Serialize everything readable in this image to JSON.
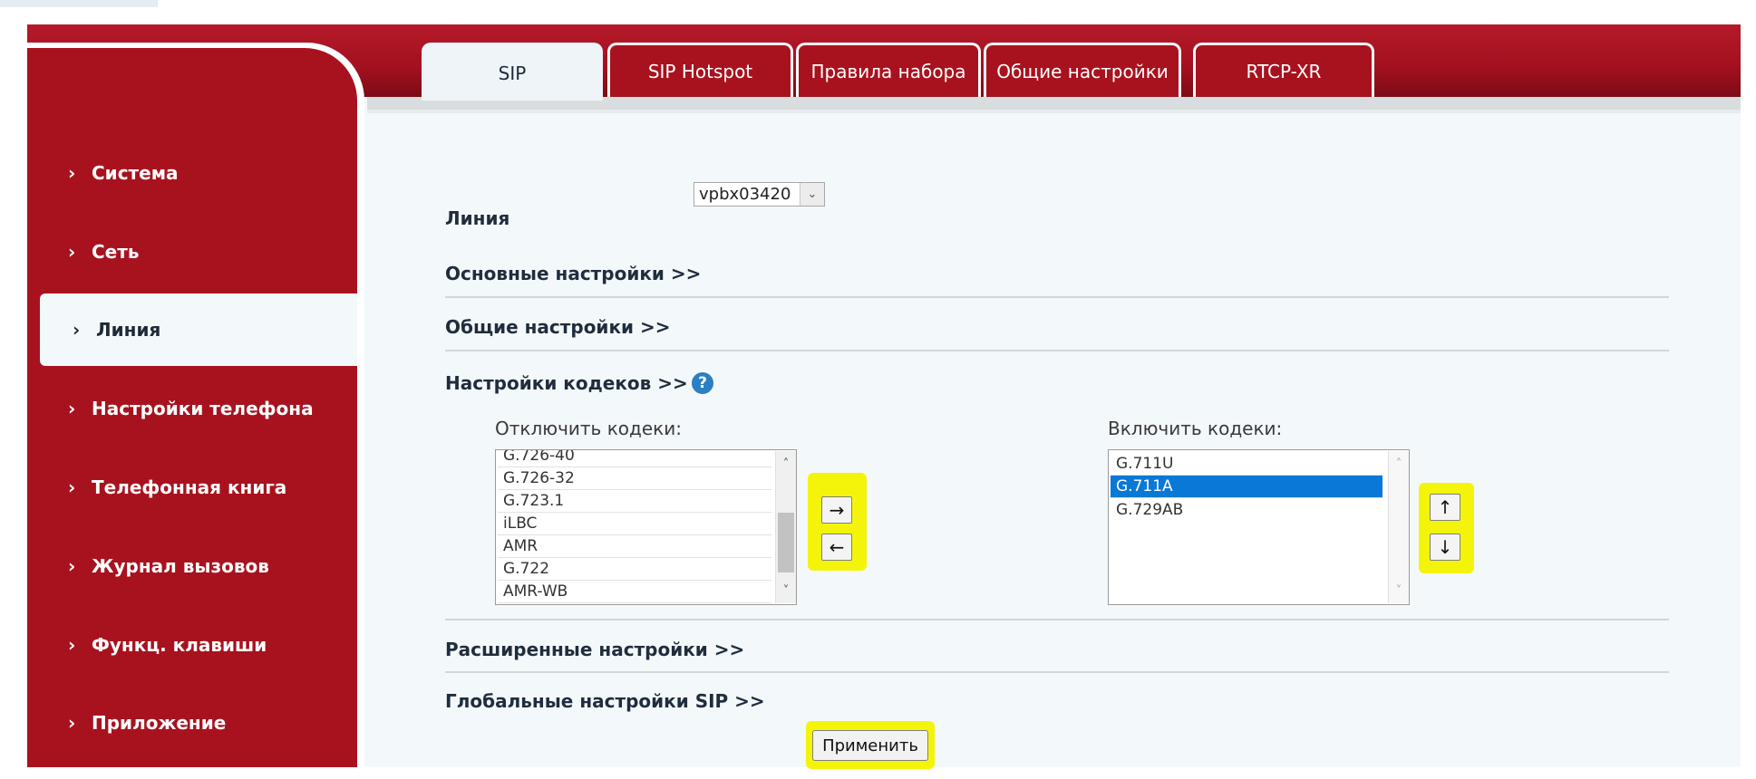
{
  "sidebar": {
    "items": [
      {
        "label": "Система"
      },
      {
        "label": "Сеть"
      },
      {
        "label": "Линия"
      },
      {
        "label": "Настройки телефона"
      },
      {
        "label": "Телефонная книга"
      },
      {
        "label": "Журнал вызовов"
      },
      {
        "label": "Функц. клавиши"
      },
      {
        "label": "Приложение"
      }
    ],
    "active": "Линия",
    "chevron": "›"
  },
  "tabs": [
    {
      "label": "SIP"
    },
    {
      "label": "SIP Hotspot"
    },
    {
      "label": "Правила набора"
    },
    {
      "label": "Общие настройки"
    },
    {
      "label": "RTCP-XR"
    }
  ],
  "line": {
    "label": "Линия",
    "selected": "vpbx03420"
  },
  "sections": {
    "basic": "Основные настройки >>",
    "general": "Общие настройки >>",
    "codecs": "Настройки кодеков >>",
    "advanced": "Расширенные настройки >>",
    "global_sip": "Глобальные настройки SIP >>"
  },
  "codecs": {
    "disabled_label": "Отключить кодеки:",
    "enabled_label": "Включить кодеки:",
    "disabled_list": [
      "G.726-40",
      "G.726-32",
      "G.723.1",
      "iLBC",
      "AMR",
      "G.722",
      "AMR-WB"
    ],
    "enabled_list": [
      "G.711U",
      "G.711A",
      "G.729AB"
    ],
    "enabled_selected": "G.711A"
  },
  "buttons": {
    "move_right": "→",
    "move_left": "←",
    "move_up": "↑",
    "move_down": "↓",
    "apply": "Применить"
  },
  "icons": {
    "help": "?",
    "dropdown": "⌄",
    "scroll_up": "˄",
    "scroll_down": "˅"
  },
  "colors": {
    "brand_red": "#a8121e",
    "highlight": "#f4f40a",
    "selection": "#0a78d6",
    "help_blue": "#2b7fc2"
  }
}
